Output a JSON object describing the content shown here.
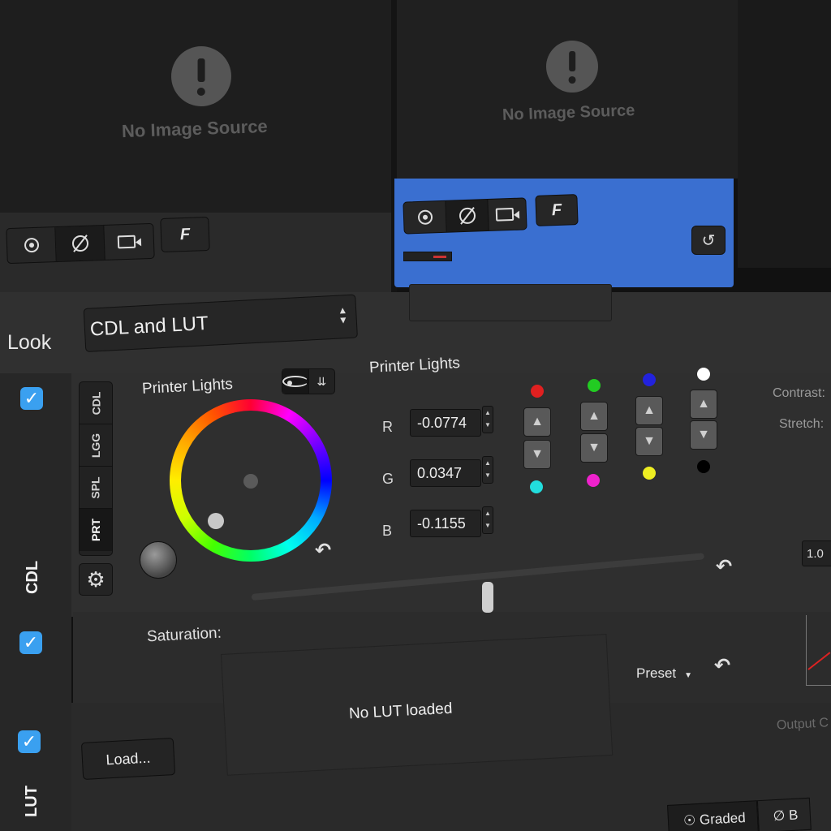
{
  "viewers": {
    "left": {
      "message": "No Image Source"
    },
    "right": {
      "message": "No Image Source"
    },
    "f_label": "F"
  },
  "look": {
    "label": "Look",
    "selected": "CDL and LUT"
  },
  "cdl": {
    "section_label": "CDL",
    "modes": [
      "CDL",
      "LGG",
      "SPL",
      "PRT"
    ],
    "active_mode": "PRT",
    "wheel_title": "Printer Lights",
    "panel_title": "Printer Lights",
    "channels": [
      {
        "label": "R",
        "value": "-0.0774"
      },
      {
        "label": "G",
        "value": "0.0347"
      },
      {
        "label": "B",
        "value": "-0.1155"
      }
    ],
    "contrast_label": "Contrast:",
    "stretch_label": "Stretch:",
    "stretch_value": "1.0"
  },
  "printer_light_dots": {
    "top": [
      "#e02020",
      "#22cc22",
      "#2222dd",
      "#ffffff"
    ],
    "bottom": [
      "#22dddd",
      "#ee22cc",
      "#eeee22",
      "#000000"
    ]
  },
  "saturation": {
    "label": "Saturation:",
    "level": 0.51
  },
  "lut": {
    "section_label": "LUT",
    "status": "No LUT loaded",
    "load_label": "Load...",
    "preset_label": "Preset",
    "output_label": "Output C"
  },
  "bottom_tabs": [
    "Graded",
    "B"
  ],
  "accent_color": "#3a6fd0",
  "checkbox_color": "#3aa0f0"
}
